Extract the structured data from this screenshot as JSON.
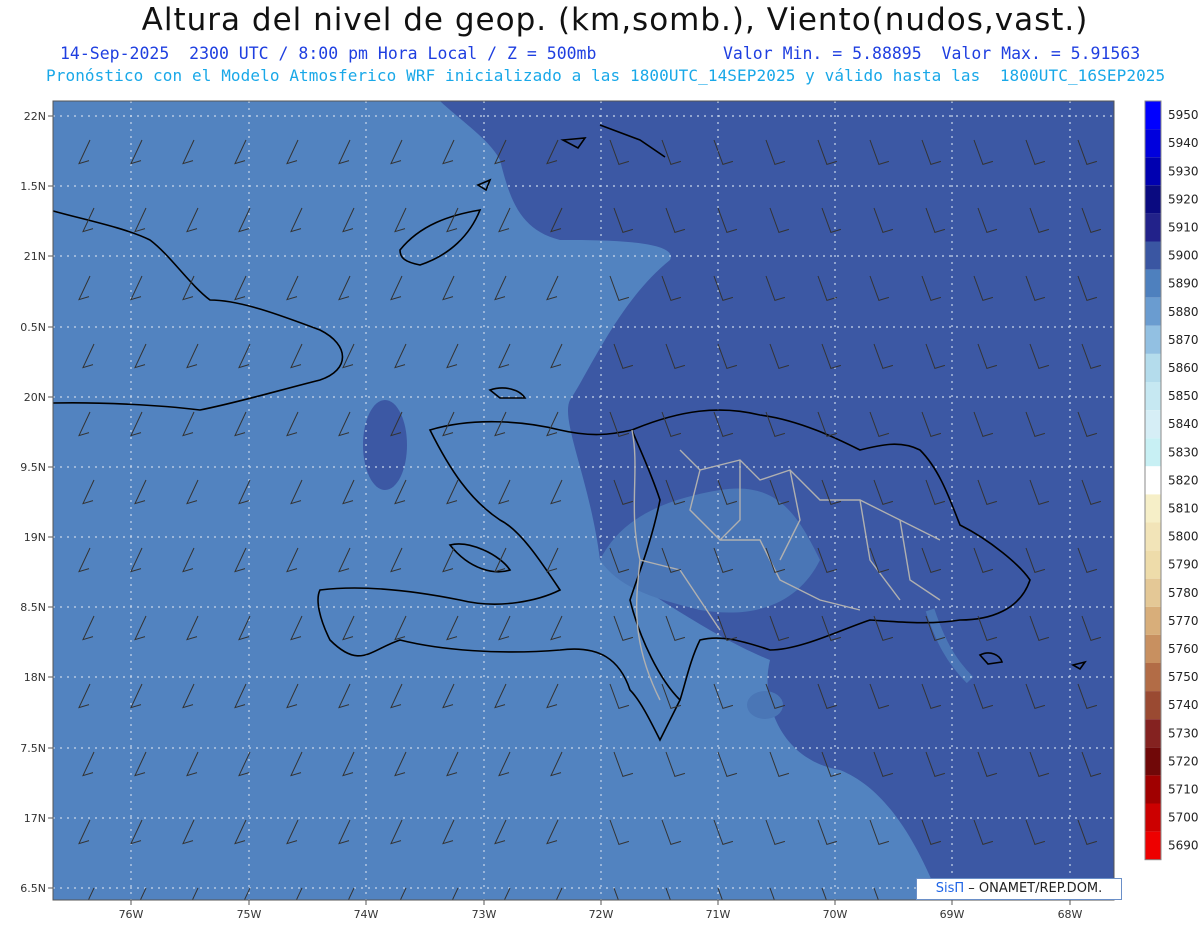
{
  "title": "Altura del nivel de geop. (km,somb.), Viento(nudos,vast.)",
  "subtitle_left": "14-Sep-2025  2300 UTC / 8:00 pm Hora Local / Z = 500mb",
  "subtitle_right": "Valor Min. = 5.88895  Valor Max. = 5.91563",
  "subtitle_model": "Pronóstico con el Modelo Atmosferico WRF inicializado a las 1800UTC_14SEP2025 y válido hasta las  1800UTC_16SEP2025",
  "credit": {
    "brand": "SisΠ",
    "text": " – ONAMET/REP.DOM."
  },
  "lat_labels": [
    "22N",
    "1.5N",
    "21N",
    "0.5N",
    "20N",
    "9.5N",
    "19N",
    "8.5N",
    "18N",
    "7.5N",
    "17N",
    "6.5N"
  ],
  "lon_labels": [
    "76W",
    "75W",
    "74W",
    "73W",
    "72W",
    "71W",
    "70W",
    "69W",
    "68W"
  ],
  "colorbar": {
    "levels": [
      "5950",
      "5940",
      "5930",
      "5920",
      "5910",
      "5900",
      "5890",
      "5880",
      "5870",
      "5860",
      "5850",
      "5840",
      "5830",
      "5820",
      "5810",
      "5800",
      "5790",
      "5780",
      "5770",
      "5760",
      "5750",
      "5740",
      "5730",
      "5720",
      "5710",
      "5700",
      "5690"
    ],
    "colors": [
      "#0000ff",
      "#0000dd",
      "#0000b0",
      "#0a0a80",
      "#22228a",
      "#3a56a2",
      "#4e80be",
      "#6a9cd0",
      "#92c0e2",
      "#b4dcec",
      "#c6e8f2",
      "#d6eef6",
      "#c8f0f4",
      "#ffffff",
      "#f6efc8",
      "#f2e4b8",
      "#eedcaa",
      "#e4c896",
      "#d8ae7a",
      "#c89060",
      "#b26c46",
      "#9a4a32",
      "#842220",
      "#700808",
      "#a00000",
      "#cc0000",
      "#ee0000"
    ]
  },
  "colors": {
    "field_low": "#4e80be",
    "field_mid": "#5a8ac4",
    "field_high": "#3a56a2",
    "coast": "#000000",
    "borders": "#b0b0b0"
  }
}
